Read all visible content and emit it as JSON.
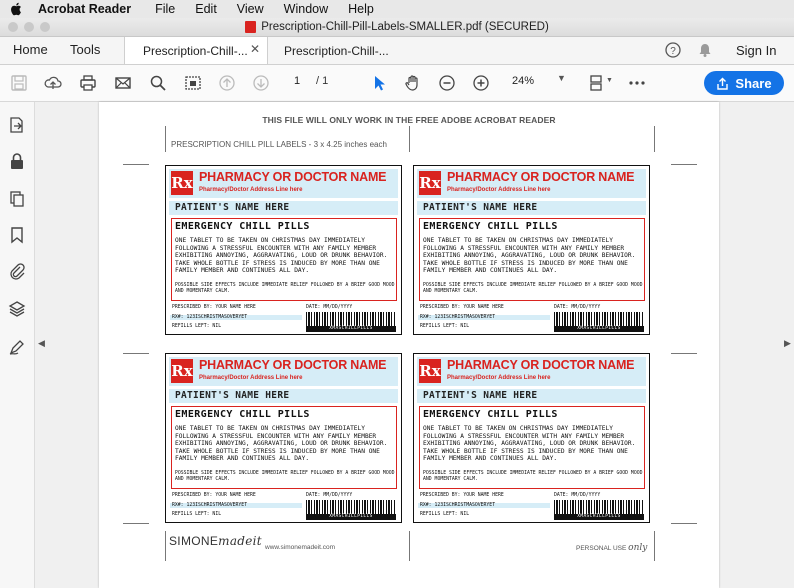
{
  "menubar": {
    "app_name": "Acrobat Reader",
    "items": [
      "File",
      "Edit",
      "View",
      "Window",
      "Help"
    ]
  },
  "window": {
    "title": "Prescription-Chill-Pill-Labels-SMALLER.pdf (SECURED)"
  },
  "tabs": {
    "home": "Home",
    "tools": "Tools",
    "doc_tabs": [
      "Prescription-Chill-...",
      "Prescription-Chill-..."
    ],
    "sign_in": "Sign In"
  },
  "toolbar": {
    "page_current": "1",
    "page_sep": "/ 1",
    "zoom": "24%",
    "share_label": "Share"
  },
  "page": {
    "notice": "THIS FILE WILL ONLY WORK IN THE FREE ADOBE ACROBAT READER",
    "subtitle": "PRESCRIPTION CHILL PILL LABELS - 3 x 4.25 inches each",
    "footer_brand_a": "SIMONE",
    "footer_brand_b": "madeit",
    "footer_url": "www.simonemadeit.com",
    "footer_use_a": "PERSONAL USE",
    "footer_use_b": "only"
  },
  "label": {
    "rx": "Rx",
    "pharmacy": "PHARMACY OR DOCTOR NAME",
    "address": "Pharmacy/Doctor Address Line here",
    "patient": "PATIENT'S NAME HERE",
    "medication": "EMERGENCY CHILL PILLS",
    "instructions": "ONE TABLET TO BE TAKEN ON CHRISTMAS DAY IMMEDIATELY FOLLOWING A STRESSFUL ENCOUNTER WITH ANY FAMILY MEMBER EXHIBITING ANNOYING, AGGRAVATING, LOUD OR DRUNK BEHAVIOR. TAKE WHOLE BOTTLE IF STRESS IS INDUCED BY MORE THAN ONE FAMILY MEMBER AND CONTINUES ALL DAY.",
    "side_effects": "POSSIBLE SIDE EFFECTS INCLUDE IMMEDIATE RELIEF FOLLOWED BY A BRIEF GOOD MOOD AND MOMENTARY CALM.",
    "prescribed_by": "PRESCRIBED BY: YOUR NAME HERE",
    "rx_number": "RX#: 123ISCHRISTMASOVERYET",
    "refills": "REFILLS LEFT: NIL",
    "date": "DATE: MM/DD/YYYY",
    "barcode_text": "XMASCHILLPILLS"
  },
  "colors": {
    "accent_red": "#d9231f",
    "header_blue": "#d6edf7",
    "share_blue": "#1473e6"
  }
}
